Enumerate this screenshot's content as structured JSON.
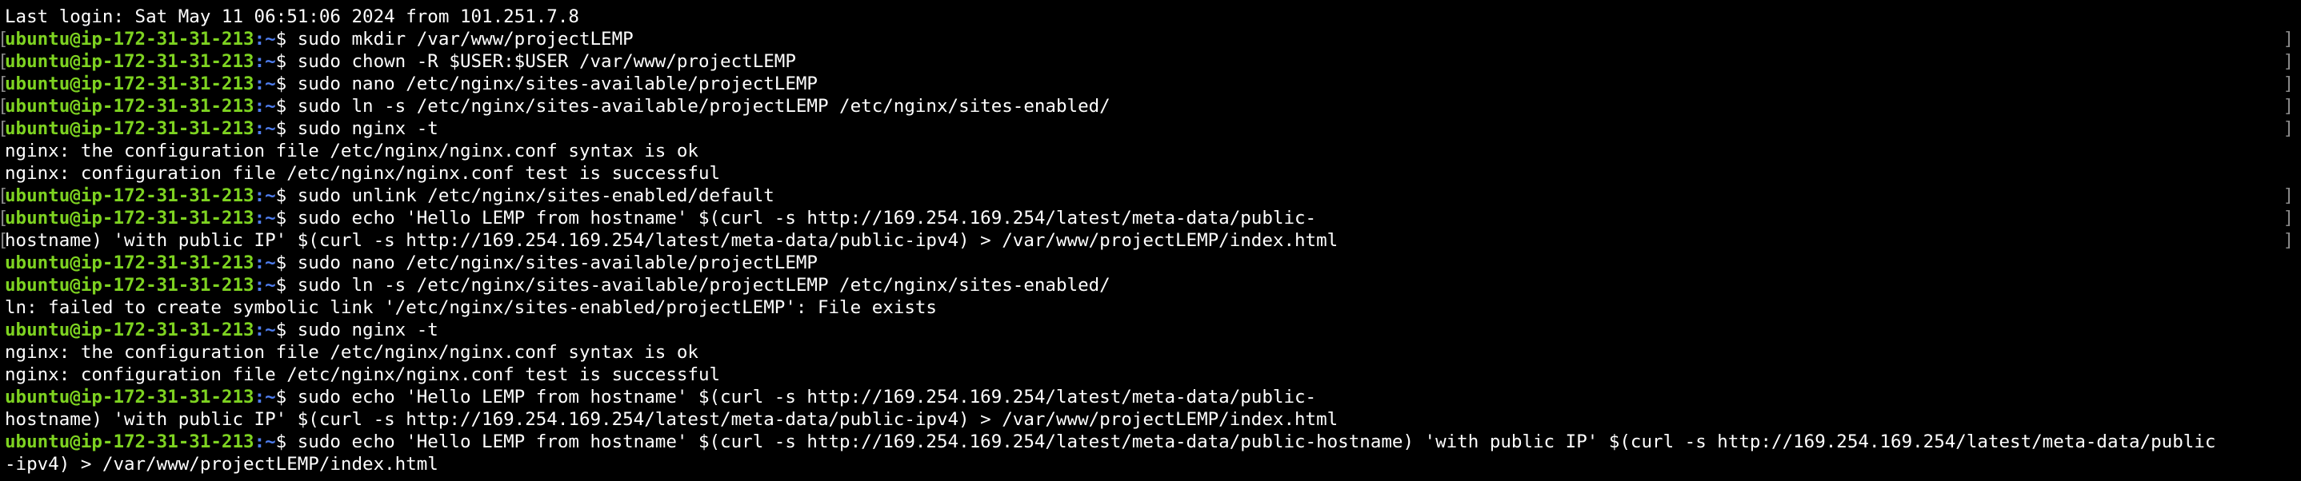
{
  "terminal": {
    "last_login": "Last login: Sat May 11 06:51:06 2024 from 101.251.7.8",
    "prompt": {
      "host": "ubuntu@ip-172-31-31-213",
      "sep": ":",
      "path": "~",
      "symbol": "$ "
    },
    "lines": [
      {
        "type": "out",
        "text": "Last login: Sat May 11 06:51:06 2024 from 101.251.7.8"
      },
      {
        "type": "cmd",
        "bracket": true,
        "text": "sudo mkdir /var/www/projectLEMP"
      },
      {
        "type": "cmd",
        "bracket": true,
        "text": "sudo chown -R $USER:$USER /var/www/projectLEMP"
      },
      {
        "type": "cmd",
        "bracket": true,
        "text": "sudo nano /etc/nginx/sites-available/projectLEMP"
      },
      {
        "type": "cmd",
        "bracket": true,
        "text": "sudo ln -s /etc/nginx/sites-available/projectLEMP /etc/nginx/sites-enabled/"
      },
      {
        "type": "cmd",
        "bracket": true,
        "text": "sudo nginx -t"
      },
      {
        "type": "out",
        "text": "nginx: the configuration file /etc/nginx/nginx.conf syntax is ok"
      },
      {
        "type": "out",
        "text": "nginx: configuration file /etc/nginx/nginx.conf test is successful"
      },
      {
        "type": "cmd",
        "bracket": true,
        "text": "sudo unlink /etc/nginx/sites-enabled/default"
      },
      {
        "type": "cmd",
        "bracket": true,
        "text": "sudo echo 'Hello LEMP from hostname' $(curl -s http://169.254.169.254/latest/meta-data/public-"
      },
      {
        "type": "out",
        "bracket": true,
        "text": "hostname) 'with public IP' $(curl -s http://169.254.169.254/latest/meta-data/public-ipv4) > /var/www/projectLEMP/index.html"
      },
      {
        "type": "cmd",
        "bracket": false,
        "text": "sudo nano /etc/nginx/sites-available/projectLEMP"
      },
      {
        "type": "cmd",
        "bracket": false,
        "text": "sudo ln -s /etc/nginx/sites-available/projectLEMP /etc/nginx/sites-enabled/"
      },
      {
        "type": "out",
        "text": "ln: failed to create symbolic link '/etc/nginx/sites-enabled/projectLEMP': File exists"
      },
      {
        "type": "cmd",
        "bracket": false,
        "text": "sudo nginx -t"
      },
      {
        "type": "out",
        "text": "nginx: the configuration file /etc/nginx/nginx.conf syntax is ok"
      },
      {
        "type": "out",
        "text": "nginx: configuration file /etc/nginx/nginx.conf test is successful"
      },
      {
        "type": "cmd",
        "bracket": false,
        "text": "sudo echo 'Hello LEMP from hostname' $(curl -s http://169.254.169.254/latest/meta-data/public-"
      },
      {
        "type": "out",
        "text": "hostname) 'with public IP' $(curl -s http://169.254.169.254/latest/meta-data/public-ipv4) > /var/www/projectLEMP/index.html"
      },
      {
        "type": "cmd",
        "bracket": false,
        "text": "sudo echo 'Hello LEMP from hostname' $(curl -s http://169.254.169.254/latest/meta-data/public-hostname) 'with public IP' $(curl -s http://169.254.169.254/latest/meta-data/public"
      },
      {
        "type": "out",
        "text": "-ipv4) > /var/www/projectLEMP/index.html"
      }
    ]
  },
  "colors": {
    "background": "#000000",
    "text": "#ffffff",
    "prompt_host": "#7ed321",
    "prompt_path": "#4f7ef0",
    "bracket": "#8a8a8a"
  }
}
